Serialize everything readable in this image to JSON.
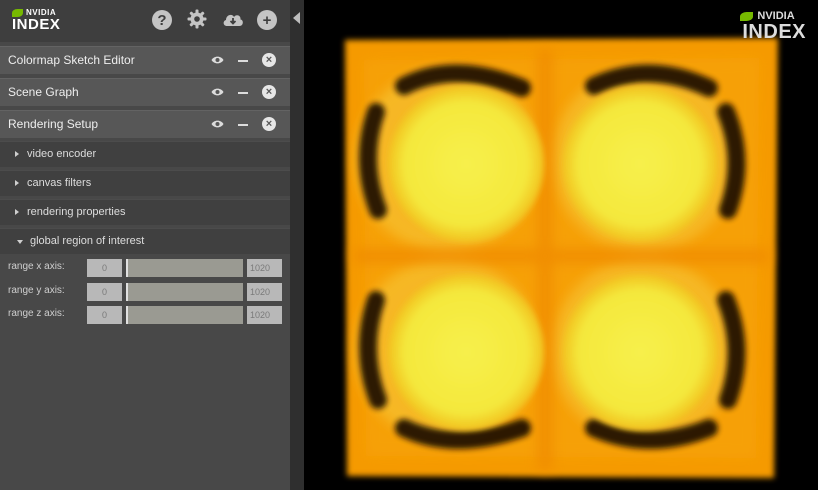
{
  "brand": {
    "company": "NVIDIA",
    "product": "INDEX"
  },
  "toolbar": {
    "icons": [
      "help-icon",
      "gear-icon",
      "cloud-download-icon",
      "add-icon"
    ],
    "help_glyph": "?",
    "add_glyph": "+"
  },
  "sections": [
    {
      "title": "Colormap Sketch Editor"
    },
    {
      "title": "Scene Graph"
    },
    {
      "title": "Rendering Setup"
    }
  ],
  "subsections": [
    {
      "title": "video encoder",
      "expanded": false
    },
    {
      "title": "canvas filters",
      "expanded": false
    },
    {
      "title": "rendering properties",
      "expanded": false
    },
    {
      "title": "global region of interest",
      "expanded": true
    }
  ],
  "roi": [
    {
      "label": "range x axis:",
      "min": "0",
      "max": "1020",
      "min_fraction": 0.0,
      "max_fraction": 1.0
    },
    {
      "label": "range y axis:",
      "min": "0",
      "max": "1020",
      "min_fraction": 0.0,
      "max_fraction": 1.0
    },
    {
      "label": "range z axis:",
      "min": "0",
      "max": "1020",
      "min_fraction": 0.0,
      "max_fraction": 1.0
    }
  ],
  "colors": {
    "panel_bg": "#484848",
    "section_bg": "#575757",
    "subsection_bg": "#404040",
    "brand_green": "#76b900",
    "volume_orange": "#f59a00",
    "volume_yellow": "#f9ef4e"
  }
}
